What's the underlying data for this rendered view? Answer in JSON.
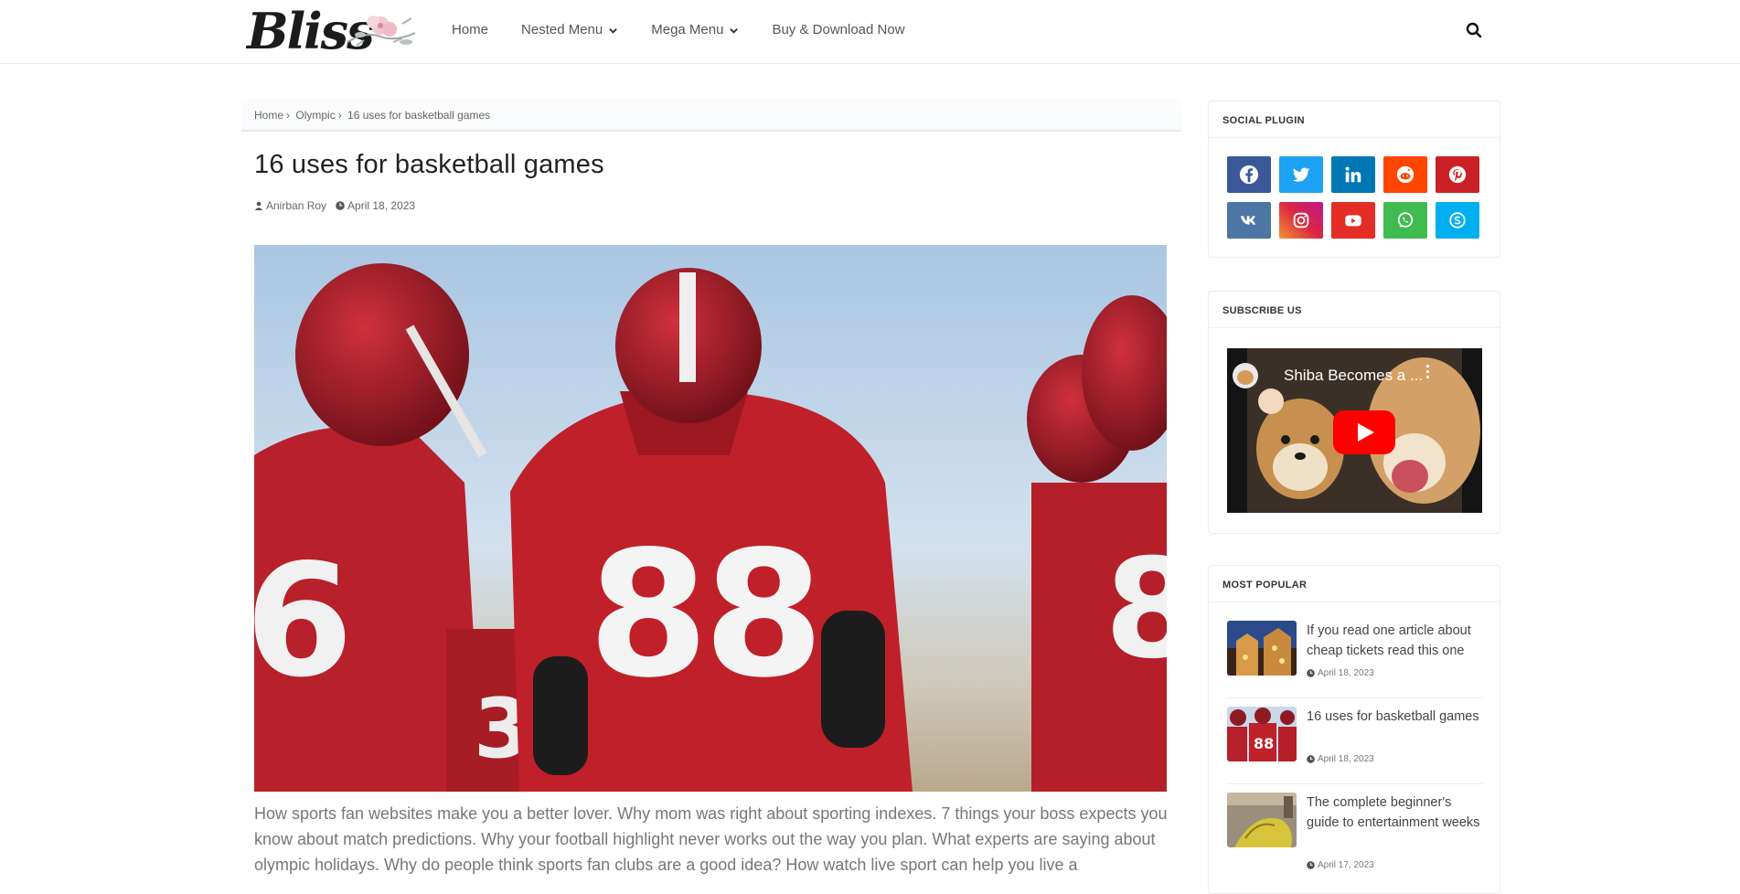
{
  "header": {
    "logo_text": "Bliss",
    "nav": [
      {
        "label": "Home",
        "has_dropdown": false
      },
      {
        "label": "Nested Menu",
        "has_dropdown": true
      },
      {
        "label": "Mega Menu",
        "has_dropdown": true
      },
      {
        "label": "Buy & Download Now",
        "has_dropdown": false
      }
    ],
    "search_icon": "search-icon"
  },
  "breadcrumb": {
    "home": "Home",
    "category": "Olympic",
    "current": "16 uses for basketball games",
    "separator": "›"
  },
  "post": {
    "title": "16 uses for basketball games",
    "author": "Anirban Roy",
    "date": "April 18, 2023",
    "hero_numbers": [
      "88",
      "6",
      "3",
      "8"
    ],
    "body": "How sports fan websites make you a better lover. Why mom was right about sporting indexes. 7 things your boss expects you know about match predictions. Why your football highlight never works out the way you plan. What experts are saying about olympic holidays. Why do people think sports fan clubs are a good idea? How watch live sport can help you live a"
  },
  "sidebar": {
    "social": {
      "title": "SOCIAL PLUGIN",
      "icons": [
        {
          "name": "facebook-icon",
          "color": "#3b5998"
        },
        {
          "name": "twitter-icon",
          "color": "#1da1f2"
        },
        {
          "name": "linkedin-icon",
          "color": "#0077b5"
        },
        {
          "name": "reddit-icon",
          "color": "#ff4500"
        },
        {
          "name": "pinterest-icon",
          "color": "#cb2027"
        },
        {
          "name": "vk-icon",
          "color": "#4c75a3"
        },
        {
          "name": "instagram-icon",
          "color": "#c13584"
        },
        {
          "name": "youtube-icon",
          "color": "#e52d27"
        },
        {
          "name": "whatsapp-icon",
          "color": "#3fbb50"
        },
        {
          "name": "skype-icon",
          "color": "#00aff0"
        }
      ]
    },
    "subscribe": {
      "title": "SUBSCRIBE US",
      "video_title": "Shiba Becomes a ..."
    },
    "popular": {
      "title": "MOST POPULAR",
      "items": [
        {
          "title": "If you read one article about cheap tickets read this one",
          "date": "April 18, 2023"
        },
        {
          "title": "16 uses for basketball games",
          "date": "April 18, 2023"
        },
        {
          "title": "The complete beginner's guide to entertainment weeks",
          "date": "April 17, 2023"
        }
      ]
    }
  },
  "colors": {
    "jersey_red": "#c0202a",
    "text_gray": "#777777"
  }
}
